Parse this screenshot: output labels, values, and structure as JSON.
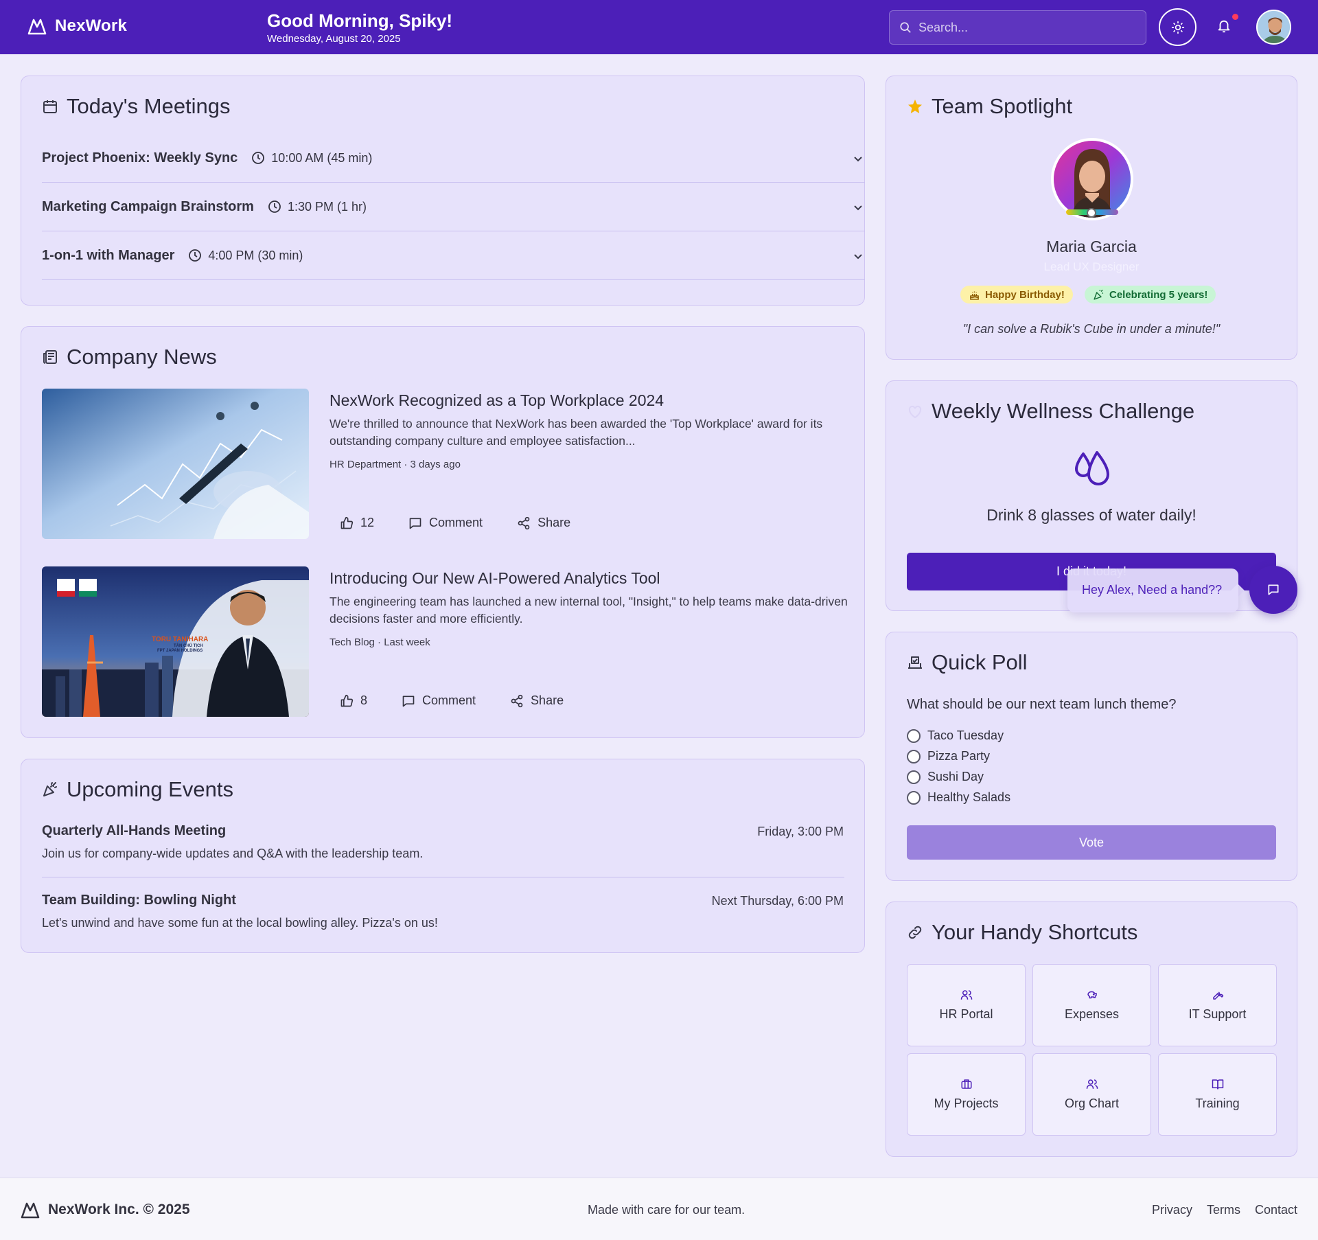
{
  "header": {
    "brand": "NexWork",
    "greeting": "Good Morning, Spiky!",
    "date": "Wednesday, August 20, 2025",
    "search_placeholder": "Search..."
  },
  "meetings": {
    "title": "Today's Meetings",
    "items": [
      {
        "title": "Project Phoenix: Weekly Sync",
        "time": "10:00 AM (45 min)"
      },
      {
        "title": "Marketing Campaign Brainstorm",
        "time": "1:30 PM (1 hr)"
      },
      {
        "title": "1-on-1 with Manager",
        "time": "4:00 PM (30 min)"
      }
    ]
  },
  "news": {
    "title": "Company News",
    "items": [
      {
        "title": "NexWork Recognized as a Top Workplace 2024",
        "body": "We're thrilled to announce that NexWork has been awarded the 'Top Workplace' award for its outstanding company culture and employee satisfaction...",
        "meta": "HR Department · 3 days ago",
        "likes": "12",
        "comment_label": "Comment",
        "share_label": "Share"
      },
      {
        "title": "Introducing Our New AI-Powered Analytics Tool",
        "body": "The engineering team has launched a new internal tool, \"Insight,\" to help teams make data-driven decisions faster and more efficiently.",
        "meta": "Tech Blog · Last week",
        "likes": "8",
        "comment_label": "Comment",
        "share_label": "Share",
        "image_caption": "TORU TANIHARA",
        "image_subcaption": "TÂN CHỦ TỊCH",
        "image_subcaption2": "FPT JAPAN HOLDINGS"
      }
    ]
  },
  "events": {
    "title": "Upcoming Events",
    "items": [
      {
        "title": "Quarterly All-Hands Meeting",
        "desc": "Join us for company-wide updates and Q&A with the leadership team.",
        "when": "Friday, 3:00 PM"
      },
      {
        "title": "Team Building: Bowling Night",
        "desc": "Let's unwind and have some fun at the local bowling alley. Pizza's on us!",
        "when": "Next Thursday, 6:00 PM"
      }
    ]
  },
  "spotlight": {
    "title": "Team Spotlight",
    "name": "Maria Garcia",
    "role": "Lead UX Designer",
    "badges": [
      "Happy Birthday!",
      "Celebrating 5 years!"
    ],
    "quote": "\"I can solve a Rubik's Cube in under a minute!\""
  },
  "wellness": {
    "title": "Weekly Wellness Challenge",
    "text": "Drink 8 glasses of water daily!",
    "button": "I did it today!"
  },
  "assistant": {
    "hint": "Hey Alex, Need a hand??"
  },
  "poll": {
    "title": "Quick Poll",
    "question": "What should be our next team lunch theme?",
    "options": [
      "Taco Tuesday",
      "Pizza Party",
      "Sushi Day",
      "Healthy Salads"
    ],
    "button": "Vote"
  },
  "shortcuts": {
    "title": "Your Handy Shortcuts",
    "items": [
      {
        "label": "HR Portal",
        "icon": "users-icon"
      },
      {
        "label": "Expenses",
        "icon": "piggy-bank-icon"
      },
      {
        "label": "IT Support",
        "icon": "wrench-icon"
      },
      {
        "label": "My Projects",
        "icon": "briefcase-icon"
      },
      {
        "label": "Org Chart",
        "icon": "users-icon"
      },
      {
        "label": "Training",
        "icon": "book-icon"
      }
    ]
  },
  "footer": {
    "brand": "NexWork Inc. © 2025",
    "tagline": "Made with care for our team.",
    "links": [
      "Privacy",
      "Terms",
      "Contact"
    ]
  },
  "colors": {
    "primary": "#4c1fb8",
    "card_bg": "#e7e2fb",
    "page_bg": "#eeebfb",
    "vote_button": "#9a82dd",
    "star": "#f5b301"
  }
}
